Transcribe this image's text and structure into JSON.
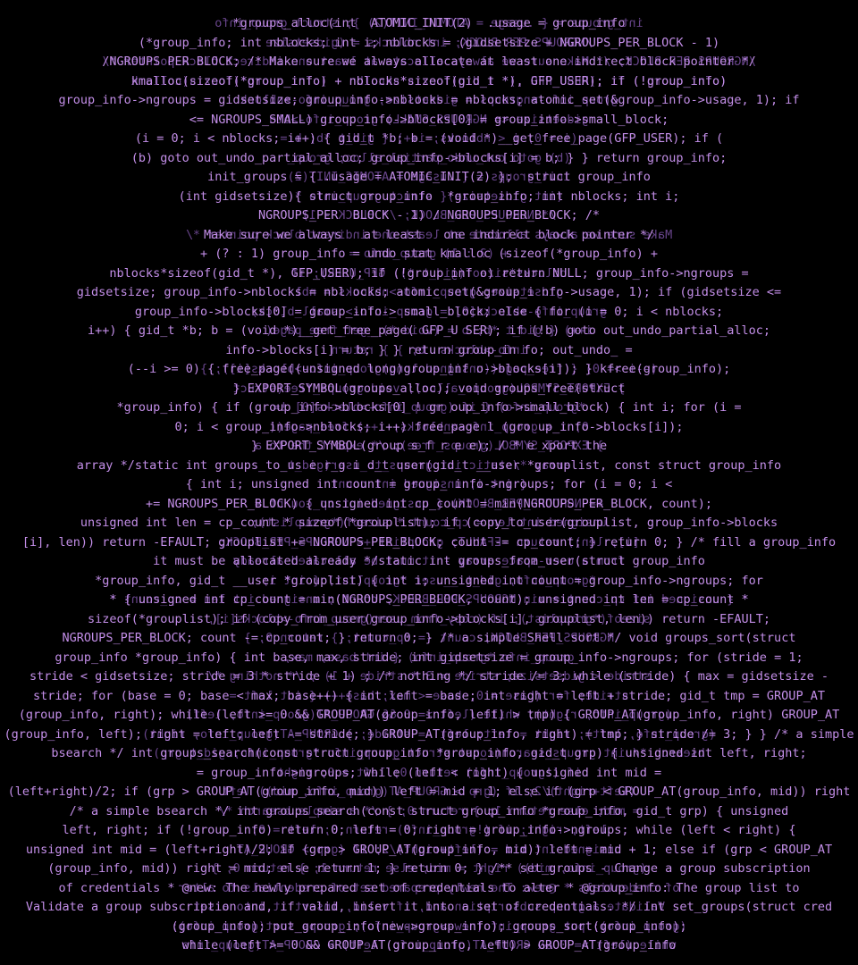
{
  "colors": {
    "background": "#000000",
    "text_primary": "#c38ee8",
    "text_mirror": "#8a5bb8"
  },
  "lines": [
    {
      "text": "*groups_alloc(int  ATOMIC_INIT(2)  .usage = group_info",
      "mirror": "int_groups = { .usage = ATOMIC_INIT(2) }; struct group_info"
    },
    {
      "text": "(*group_info; int nblocks; int i; nblocks = (gidsetsize + NGROUPS_PER_BLOCK - 1)",
      "mirror": "/NGROUPS PER BLOCK; int nblocks = (gidsetsize"
    },
    {
      "text": "/NGROUPS PER BLOCK; /* Make sure we always allocate at least one indirect block pointer */",
      "mirror": "/NGROUPS PER BLOCK; /* Make sure we always allocate at least one indirect block pointer */"
    },
    {
      "text": "kmalloc(sizeof(*group_info) + nblocks*sizeof(gid_t *), GFP_USER); if (!group_info)",
      "mirror": "(ofni_quorg!) fi ;)RESU_PFG ,)* t_dig(foezis*skcolbn + )ofni_quorg*(foezis(collamk"
    },
    {
      "text": "group_info->ngroups = gidsetsize; group_info->nblocks = nblocks; atomic_set(&group_info->usage, 1); if",
      "mirror": "group_info->ngroups = gidsetsize; group_info->nblock"
    },
    {
      "text": "<= NGROUPS_SMALL) group_info->blocks[0] = group_info->small_block;",
      "mirror": "gidsetsize <= NGROUPS_SMALL) group_info->blo"
    },
    {
      "text": "(i = 0; i < nblocks; i++) { gid_t *b; b = (void *)__get_free_page(GFP_USER); if (",
      "mirror": "(i = 0; i < nblocks; i++) { gid_t *b; b ="
    },
    {
      "text": "(b) goto out_undo_partial_alloc; group_info->blocks[i] = b; } } return group_info;",
      "mirror": "(b) goto out_undo_partial_alloc; group_"
    },
    {
      "text": "init_groups = { .usage = ATOMIC_INIT(2) };  struct group_info",
      "mirror": "init_groups = { .usage = ATOMIC_INIT(2)"
    },
    {
      "text": "(int gidsetsize){ struct group_info  *group_info; int nblocks; int i;",
      "mirror": "(int gidsetsize){ struct group_info *"
    },
    {
      "text": "NGROUPS_PER  BLOCK - 1) / NGROUPS_PER_BLOCK; /*",
      "mirror": "/* NGROUPS_PER_BLOCK; /* BLOCK - 1)"
    },
    {
      "text": "Make sure we always   at least   one indirect block pointer */",
      "mirror": "Make sure we always allocate at least one indirect block pointer */"
    },
    {
      "text": "+ (? : 1) group_info = undo stat kmalloc (sizeof(*group_info) +",
      "mirror": "+ (? : 1) group_info ="
    },
    {
      "text": "nblocks*sizeof(gid_t *), GFP_USER); if (!group_inf o) return NULL; group_info->ngroups =",
      "mirror": "nblocks*sizeof(gid_t *), GFP_USER); if"
    },
    {
      "text": "gidsetsize; group_info->nblocks = nbl ocks; atomic set(&group_i nfo->usage, 1); if (gidsetsize <=",
      "mirror": "gidsetsize; group_info->nblocks = nbl"
    },
    {
      "text": "group_info->blocks[0] = group_info-> small_block; else { for (i = 0; i < nblocks;",
      "mirror": "group_info->blocks[0] = group_info-> small_block;"
    },
    {
      "text": "i++) { gid_t *b; b = (void *)__get_free_page( GFP_U SER); if (!b) goto out_undo_partial_alloc;",
      "mirror": "i++) { gid_t *b; b = (void *)__get_free_page("
    },
    {
      "text": "info->blocks[i] = b; } } return group_in fo; out_undo_ =",
      "mirror": "info->blocks  b; } } return"
    },
    {
      "text": "(--i >= 0) { free_page((unsigned long)group_inf o->blocks[i]); } kfree(group_info);",
      "mirror": "(--i >= 0) { free_page((unsigned long)group_info->blocks[i]); }"
    },
    {
      "text": "} EXPORT_SYMBOL(groups_alloc); void groups_free(struct",
      "mirror": "} EXPORT_SYMBOL(groups_alloc); void groups_free(struct"
    },
    {
      "text": "*group_info) { if (group_info->blocks[0] ! gr oup_info->small_block) { int i; for (i =",
      "mirror": "*group_info) { if (group_info->blocks[0] !="
    },
    {
      "text": "0; i < group_info->nblocks; i++) free_page l (gro up_info->blocks[i]);",
      "mirror": "0; i < group_info->nblocks; i++) free_page(("
    },
    {
      "text": "} EXPORT_SYMBOL(group s_f r e e); / * e xport the",
      "mirror": "} EXPORT_SYMBOL(groups_free); /* export the to a"
    },
    {
      "text": "array */static int groups_to_us e r_g i d_t user(gid_t __user *grouplist, const struct group_info",
      "mirror": "array */static int groups_to_user(gid_t"
    },
    {
      "text": "{ int i; unsigned int count = group_ info->ngroups; for (i = 0; i <",
      "mirror": "{ int i; unsigned int count"
    },
    {
      "text": "+= NGROUPS_PER_BLOCK) { unsigned int cp_count = min(NGROUPS_PER_BLOCK, count);",
      "mirror": "+= NGROUPS_PER_BLOCK) { unsigned int cp_cou nt ="
    },
    {
      "text": "unsigned int len = cp_count * sizeof(*grouplist); if (copy_to_user(grouplist, group_info->blocks",
      "mirror": "unsigned int len = cp_count * sizeof(*grouplist);"
    },
    {
      "text": "[i], len)) return -EFAULT; grouplist += NGROUPS_PER_BLOCK; count -= cp_count; } return 0; } /* fill a group_info",
      "mirror": "[i], len)) return -EFAULT; grouplist += NGROUPS_PER_BLOCK;"
    },
    {
      "text": "it must be allocated already */static int groups_from_user(struct group_info",
      "mirror": "from a user-space array - it must be allocated already"
    },
    {
      "text": "*group_info, gid_t __user *grouplist) { int i; unsigned int count = group_info->ngroups; for",
      "mirror": "*group_info, gid_t __user *grouplist) { int i;"
    },
    {
      "text": "* { unsigned int cp_count = min(NGROUPS_PER_BLOCK, count); unsigned int len = cp_count *",
      "mirror": "* { unsigned int cp_count = min(NGROUPS_PER_BLOCK, count); unsigned int len = cp_count *"
    },
    {
      "text": "sizeof(*grouplist); if (copy_from_user(group_info->blocks[i], grouplist, len)) return -EFAULT;",
      "mirror": "sizeof(*grouplist); if (copy_from_user(group_info->blocks[i],"
    },
    {
      "text": "NGROUPS_PER_BLOCK; count -= cp_count; } return 0; } /* a simple Shell sort */ void groups_sort(struct",
      "mirror": "NGROUPS_PER_BLOCK; count -= cp_count; } return 0; }"
    },
    {
      "text": "group_info *group_info) { int base, max, stride; int gidsetsize = group_info->ngroups; for (stride = 1;",
      "mirror": "group_info *group_info) { int base, max,"
    },
    {
      "text": "stride < gidsetsize; stride = 3 * stride + 1) ; /* nothing */ stride /= 3; while (stride) { max = gidsetsize -",
      "mirror": "stride < gidsetsize; stride = 3 * stride + 1) ; /* nothing */"
    },
    {
      "text": "stride; for (base = 0; base < max; base++) { int left = base; int right = left + stride; gid_t tmp = GROUP_AT",
      "mirror": "stride; for (base = 0; base < max; base++) { int left ="
    },
    {
      "text": "(group_info, right); while (left >= 0 && GROUP_AT(group_info, left) > tmp) { GROUP_AT(group_info, right) GROUP_AT",
      "mirror": "(group_info, right); while (left >= 0 && GROUP_AT(group_info, left)"
    },
    {
      "text": "(group_info, left); right = left; left -= stride; } GROUP_AT(group_info, right) = tmp; } stride /= 3; } } /* a simple",
      "mirror": "(group_info, left); right = left; left -= stride; } GROUP_AT(group_info, right)"
    },
    {
      "text": "bsearch */ int groups_search(const struct group_info *group_info, gid_t grp) { unsigned int left, right;",
      "mirror": "bsearch */ int groups_search(const struct group_info *group_info, gid_t grp)"
    },
    {
      "text": "= group_info->ngroups; while (left < right) { unsigned int mid =",
      "mirror": "if (!group_info) return 0; left = 0; right"
    },
    {
      "text": "(left+right)/2; if (grp > GROUP_AT(group_info, mid)) left = mid + 1; else if (grp < GROUP_AT(group_info, mid)) right",
      "mirror": "(left+right)/2; if (grp > GROUP_AT(group_info, mid)) left"
    },
    {
      "text": "/* a simple bsearch */ int groups_search(const struct group_info *group_info, gid_t grp) { unsigned",
      "mirror": "= mid; else return 1; } return 0; } /* a simple bsearch */"
    },
    {
      "text": "left, right; if (!group_info) return 0; left = 0; right = group_info->ngroups; while (left < right) {",
      "mirror": "left, right; if (!group_info) return 0; left = 0;"
    },
    {
      "text": "unsigned int mid = (left+right)/2; if (grp > GROUP_AT(group_info, mid)) left = mid + 1; else if (grp < GROUP_AT",
      "mirror": "unsigned int mid = (left+right)/2; if (grp > GROUP_AT"
    },
    {
      "text": "(group_info, mid)) right = mid; else return 1; } return 0; } /** set_groups - Change a group subscription",
      "mirror": "(group_info, mid)) right = mid; else return 1; } return 0; }"
    },
    {
      "text": "of credentials * @new: The newly prepared set of credentials to alter * @group_info: The group list to",
      "mirror": "of credentials * @new: The newly prepared set of credentials to alter"
    },
    {
      "text": "Validate a group subscription and, if valid, insert it into a set of credentials. */ int set_groups(struct cred",
      "mirror": "Validate a group subscription and, if valid, insert it into a set"
    },
    {
      "text": "(group_info); put_group_info(new->group_info); groups_sort(group_info);",
      "mirror": "(group_info); put_group_info(new->group_info); groups_sort(group_info);"
    },
    {
      "text": "while (left >= 0 && GROUP_AT(group_info, left) > GROUP_AT(group_info",
      "mirror": "while (left >= 0 && GROUP_AT(group_info, left) > GROUP_AT(group_info"
    }
  ]
}
